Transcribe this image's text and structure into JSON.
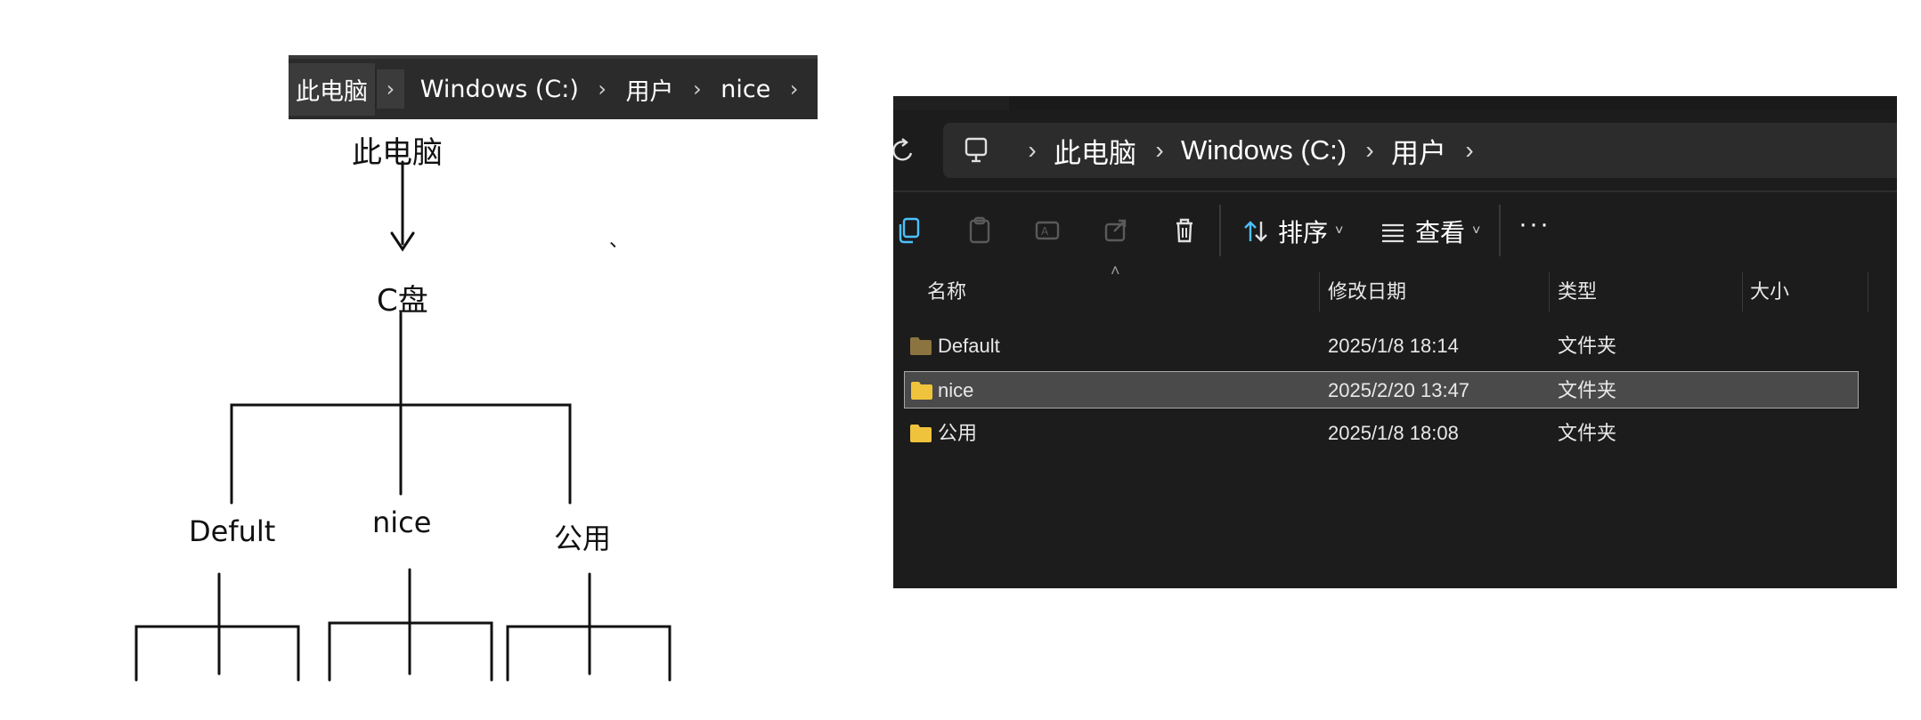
{
  "mini_breadcrumb": {
    "items": [
      "此电脑",
      "Windows (C:)",
      "用户",
      "nice"
    ]
  },
  "tree": {
    "root": "此电脑",
    "drive": "C盘",
    "children": [
      "Defult",
      "nice",
      "公用"
    ],
    "stray_mark": "、"
  },
  "explorer": {
    "breadcrumb": [
      "此电脑",
      "Windows (C:)",
      "用户"
    ],
    "toolbar": {
      "sort_label": "排序",
      "view_label": "查看",
      "more_label": "···"
    },
    "columns": [
      "名称",
      "修改日期",
      "类型",
      "大小"
    ],
    "files": [
      {
        "name": "Default",
        "modified": "2025/1/8 18:14",
        "type": "文件夹",
        "size": "",
        "selected": false,
        "folder_color": "#8c7440"
      },
      {
        "name": "nice",
        "modified": "2025/2/20 13:47",
        "type": "文件夹",
        "size": "",
        "selected": true,
        "folder_color": "#f0c33c"
      },
      {
        "name": "公用",
        "modified": "2025/1/8 18:08",
        "type": "文件夹",
        "size": "",
        "selected": false,
        "folder_color": "#f0c33c"
      }
    ],
    "colors": {
      "background": "#1c1c1c",
      "address_bg": "#2c2c2c",
      "accent": "#4cc2ff",
      "selected_row": "#4a4a4a"
    }
  }
}
